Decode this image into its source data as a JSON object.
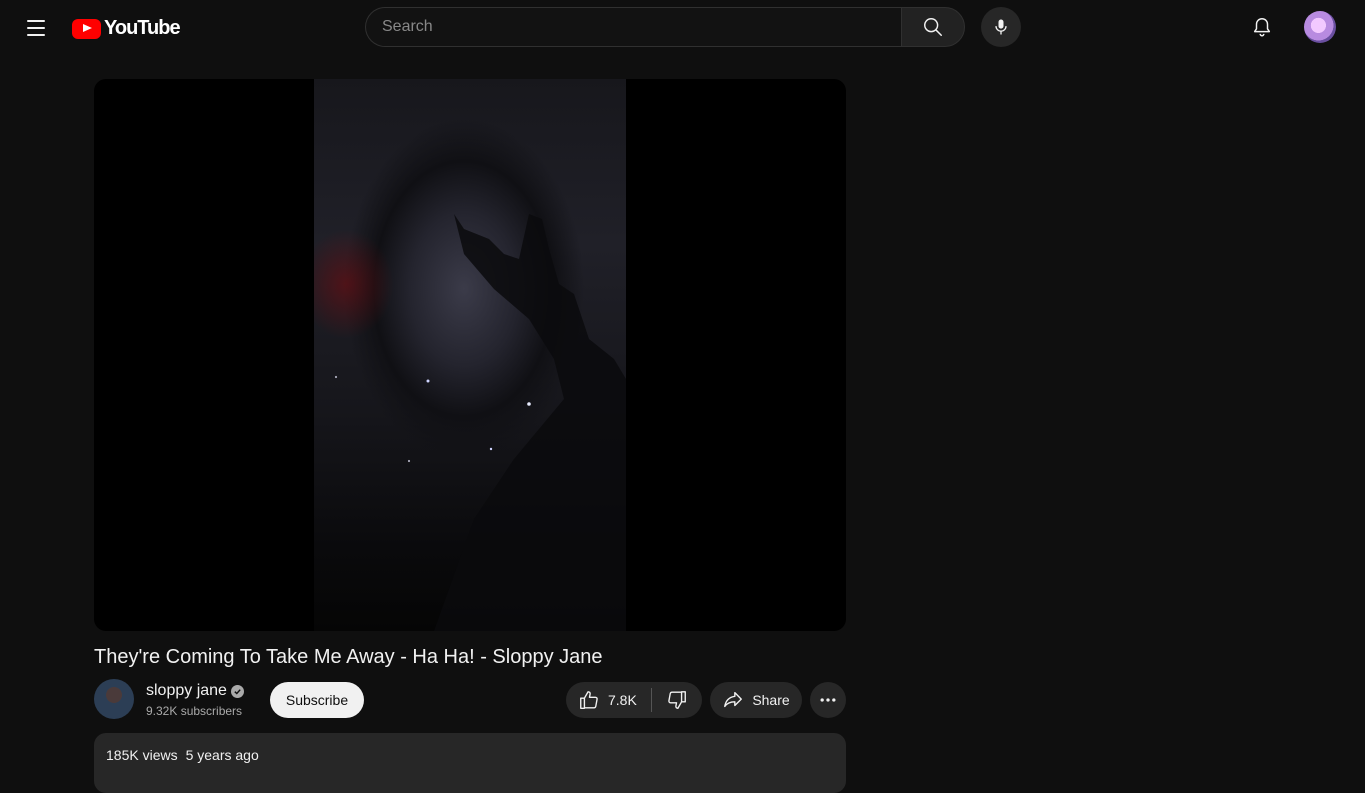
{
  "header": {
    "logo_text": "YouTube",
    "search_placeholder": "Search",
    "search_value": ""
  },
  "video": {
    "title": "They're Coming To Take Me Away - Ha Ha! - Sloppy Jane"
  },
  "channel": {
    "name": "sloppy jane",
    "subscribers": "9.32K subscribers",
    "subscribe_label": "Subscribe"
  },
  "actions": {
    "like_count": "7.8K",
    "share_label": "Share"
  },
  "description": {
    "views": "185K views",
    "age": "5 years ago"
  },
  "colors": {
    "background": "#0f0f0f",
    "brand_red": "#ff0000",
    "button_bg": "#272727",
    "subscribe_bg": "#f1f1f1"
  }
}
